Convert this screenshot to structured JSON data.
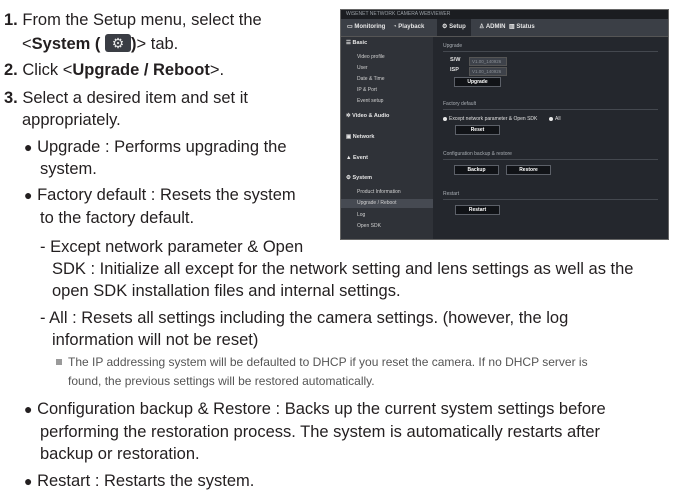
{
  "steps": [
    {
      "num": "1.",
      "line1": "From the Setup menu, select the",
      "pre": "<",
      "bold": "System (",
      "gear_icon": "gear-icon",
      "bold_end": ")",
      "post": "> tab."
    },
    {
      "num": "2.",
      "pre": "Click <",
      "bold": "Upgrade / Reboot",
      "post": ">."
    },
    {
      "num": "3.",
      "line1": "Select a desired item and set it",
      "line2": "appropriately."
    }
  ],
  "bullets": {
    "upgrade_l1": "Upgrade : Performs upgrading the",
    "upgrade_l2": "system.",
    "factory_l1": "Factory default : Resets the system",
    "factory_l2": "to the factory default.",
    "except_l1": "- Except network parameter & Open",
    "except_l2": "SDK : Initialize all except for the network setting and lens settings as well as the",
    "except_l3": "open SDK installation files and internal settings.",
    "all_l1": "- All : Resets all settings including the camera settings. (however, the log",
    "all_l2": "information will not be reset)",
    "note_l1": "The IP addressing system will be defaulted to DHCP if you reset the camera. If no DHCP server is",
    "note_l2": "found, the previous settings will be restored automatically.",
    "backup_l1": "Configuration backup & Restore : Backs up the current system settings before",
    "backup_l2": "performing the restoration process. The system is automatically restarts after",
    "backup_l3": "backup or restoration.",
    "restart_l1": "Restart : Restarts the system."
  },
  "screenshot": {
    "app_title": "WiSENET NETWORK CAMERA WEBVIEWER",
    "tabs": [
      "Monitoring",
      "Playback",
      "Setup",
      "ADMIN",
      "Status"
    ],
    "sidebar": {
      "basic": "Basic",
      "basic_items": [
        "Video profile",
        "User",
        "Date & Time",
        "IP & Port",
        "Event setup"
      ],
      "video_audio": "Video & Audio",
      "network": "Network",
      "event": "Event",
      "system": "System",
      "system_items": [
        "Product Information",
        "Upgrade / Reboot",
        "Log",
        "Open SDK"
      ]
    },
    "upgrade": {
      "title": "Upgrade",
      "sw_label": "S/W",
      "isp_label": "ISP",
      "sw_value": "V1.00_140926",
      "isp_value": "V1.00_140926",
      "button": "Upgrade"
    },
    "factory": {
      "title": "Factory default",
      "option1": "Except network parameter & Open SDK",
      "option2": "All",
      "button": "Reset"
    },
    "backup": {
      "title": "Configuration backup & restore",
      "backup_button": "Backup",
      "restore_button": "Restore"
    },
    "restart": {
      "title": "Restart",
      "button": "Restart"
    }
  }
}
